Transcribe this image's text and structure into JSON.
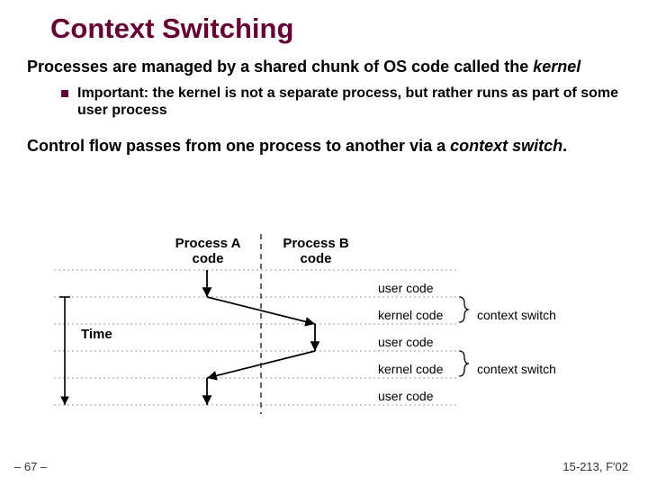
{
  "title": "Context Switching",
  "p1_a": "Processes are managed by a shared chunk of OS code called the ",
  "p1_b": "kernel",
  "bullet1": "Important: the kernel is not a separate process, but rather runs as part of some user process",
  "p2_a": "Control flow passes from one process to another via a ",
  "p2_b": "context switch",
  "p2_c": ".",
  "diagram": {
    "procA": "Process A\ncode",
    "procB": "Process B\ncode",
    "time": "Time",
    "rows": {
      "r0": "user code",
      "r1": "kernel code",
      "r2": "user code",
      "r3": "kernel code",
      "r4": "user code"
    },
    "brace1": "context switch",
    "brace2": "context switch"
  },
  "footer": {
    "page": "– 67 –",
    "course": "15-213, F'02"
  }
}
